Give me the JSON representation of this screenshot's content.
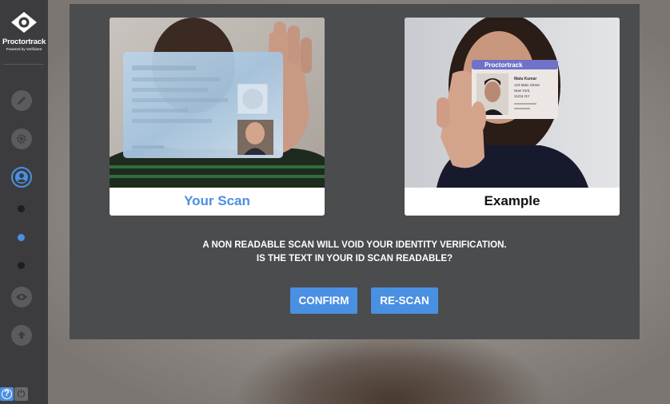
{
  "sidebar": {
    "logo_text": "Proctortrack",
    "logo_sub": "Powered by Verificient",
    "icons": [
      "pencil-icon",
      "gear-icon",
      "user-icon",
      "eye-icon",
      "upload-icon"
    ],
    "steps": [
      "step-1",
      "step-2",
      "step-3"
    ],
    "help_symbol": "?",
    "power_symbol": "⏻"
  },
  "modal": {
    "your_scan_label": "Your Scan",
    "example_label": "Example",
    "message_line1": "A NON READABLE SCAN WILL VOID YOUR IDENTITY VERIFICATION.",
    "message_line2": "IS THE TEXT IN YOUR ID SCAN READABLE?",
    "confirm_label": "CONFIRM",
    "rescan_label": "RE-SCAN"
  },
  "example_id": {
    "brand": "Proctortrack",
    "name": "Mala Kumar",
    "address1": "123 Main Street",
    "address2": "New York,",
    "address3": "11211 NY"
  },
  "colors": {
    "accent": "#4a90e2",
    "sidebar": "#3c3c3e",
    "modal": "#4b4c4e"
  }
}
